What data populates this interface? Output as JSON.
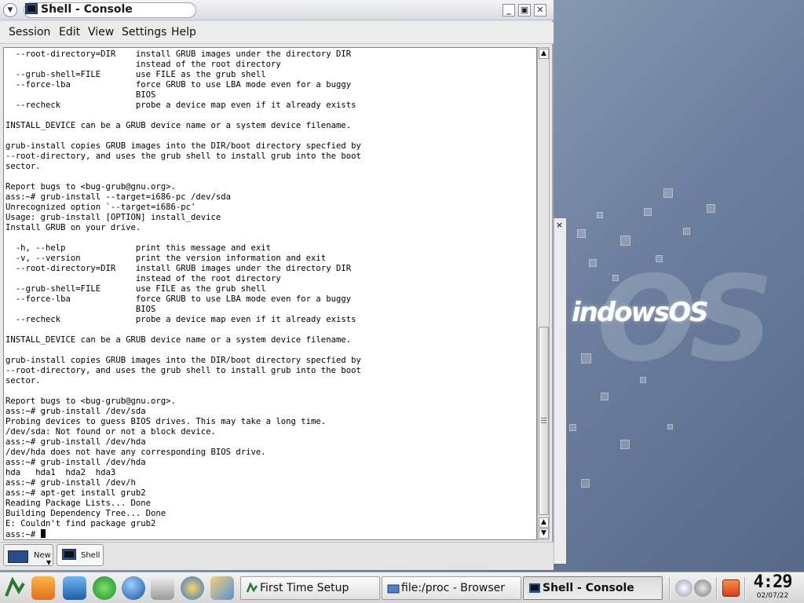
{
  "window": {
    "title": "Shell - Console",
    "menu": [
      "Session",
      "Edit",
      "View",
      "Settings",
      "Help"
    ],
    "tabs": {
      "new_label": "New",
      "shell_label": "Shell"
    }
  },
  "terminal": {
    "lines": [
      "  --root-directory=DIR    install GRUB images under the directory DIR",
      "                          instead of the root directory",
      "  --grub-shell=FILE       use FILE as the grub shell",
      "  --force-lba             force GRUB to use LBA mode even for a buggy",
      "                          BIOS",
      "  --recheck               probe a device map even if it already exists",
      "",
      "INSTALL_DEVICE can be a GRUB device name or a system device filename.",
      "",
      "grub-install copies GRUB images into the DIR/boot directory specfied by",
      "--root-directory, and uses the grub shell to install grub into the boot",
      "sector.",
      "",
      "Report bugs to <bug-grub@gnu.org>.",
      "ass:~# grub-install --target=i686-pc /dev/sda",
      "Unrecognized option `--target=i686-pc'",
      "Usage: grub-install [OPTION] install_device",
      "Install GRUB on your drive.",
      "",
      "  -h, --help              print this message and exit",
      "  -v, --version           print the version information and exit",
      "  --root-directory=DIR    install GRUB images under the directory DIR",
      "                          instead of the root directory",
      "  --grub-shell=FILE       use FILE as the grub shell",
      "  --force-lba             force GRUB to use LBA mode even for a buggy",
      "                          BIOS",
      "  --recheck               probe a device map even if it already exists",
      "",
      "INSTALL_DEVICE can be a GRUB device name or a system device filename.",
      "",
      "grub-install copies GRUB images into the DIR/boot directory specfied by",
      "--root-directory, and uses the grub shell to install grub into the boot",
      "sector.",
      "",
      "Report bugs to <bug-grub@gnu.org>.",
      "ass:~# grub-install /dev/sda",
      "Probing devices to guess BIOS drives. This may take a long time.",
      "/dev/sda: Not found or not a block device.",
      "ass:~# grub-install /dev/hda",
      "/dev/hda does not have any corresponding BIOS drive.",
      "ass:~# grub-install /dev/hda",
      "hda   hda1  hda2  hda3",
      "ass:~# grub-install /dev/h",
      "ass:~# apt-get install grub2",
      "Reading Package Lists... Done",
      "Building Dependency Tree... Done",
      "E: Couldn't find package grub2"
    ],
    "prompt": "ass:~# "
  },
  "desktop": {
    "brand": "indowsOS",
    "panel_close": "×"
  },
  "taskbar": {
    "tasks": [
      {
        "label": "First Time Setup",
        "icon": "setup-icon",
        "active": false
      },
      {
        "label": "file:/proc - Browser",
        "icon": "folder-icon",
        "active": false
      },
      {
        "label": "Shell - Console",
        "icon": "console-icon",
        "active": true
      }
    ],
    "clock": {
      "time": "4:29",
      "date": "02/07/22"
    }
  }
}
